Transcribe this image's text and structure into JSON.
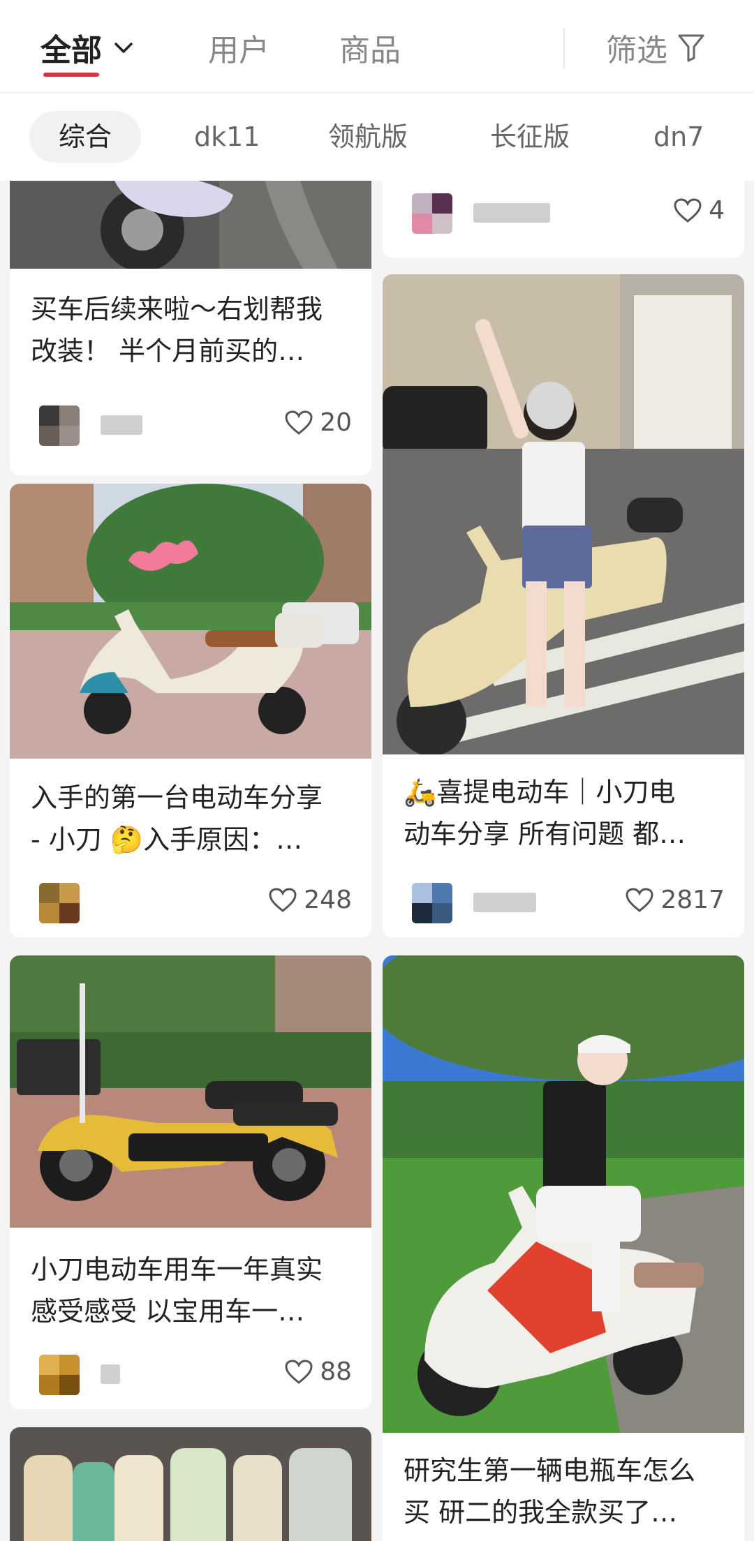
{
  "tabs": {
    "all": "全部",
    "users": "用户",
    "goods": "商品",
    "filter": "筛选"
  },
  "chips": [
    "综合",
    "dk11",
    "领航版",
    "长征版",
    "dn7"
  ],
  "colors": {
    "accent": "#e03048"
  },
  "feed": {
    "left": [
      {
        "title": "买车后续来啦～右划帮我\n改装！ 半个月前买的…",
        "likes": "20"
      },
      {
        "title": "入手的第一台电动车分享\n- 小刀 🤔入手原因：…",
        "likes": "248"
      },
      {
        "title": "小刀电动车用车一年真实\n感受感受 以宝用车一…",
        "likes": "88"
      }
    ],
    "right": [
      {
        "likes": "4"
      },
      {
        "title": "🛵喜提电动车｜小刀电\n动车分享 所有问题 都…",
        "likes": "2817"
      },
      {
        "title": "研究生第一辆电瓶车怎么\n买 研二的我全款买了…"
      }
    ]
  },
  "icons": {
    "chevron": "chevron-down-icon",
    "filter": "filter-funnel-icon",
    "heart": "heart-outline-icon"
  }
}
